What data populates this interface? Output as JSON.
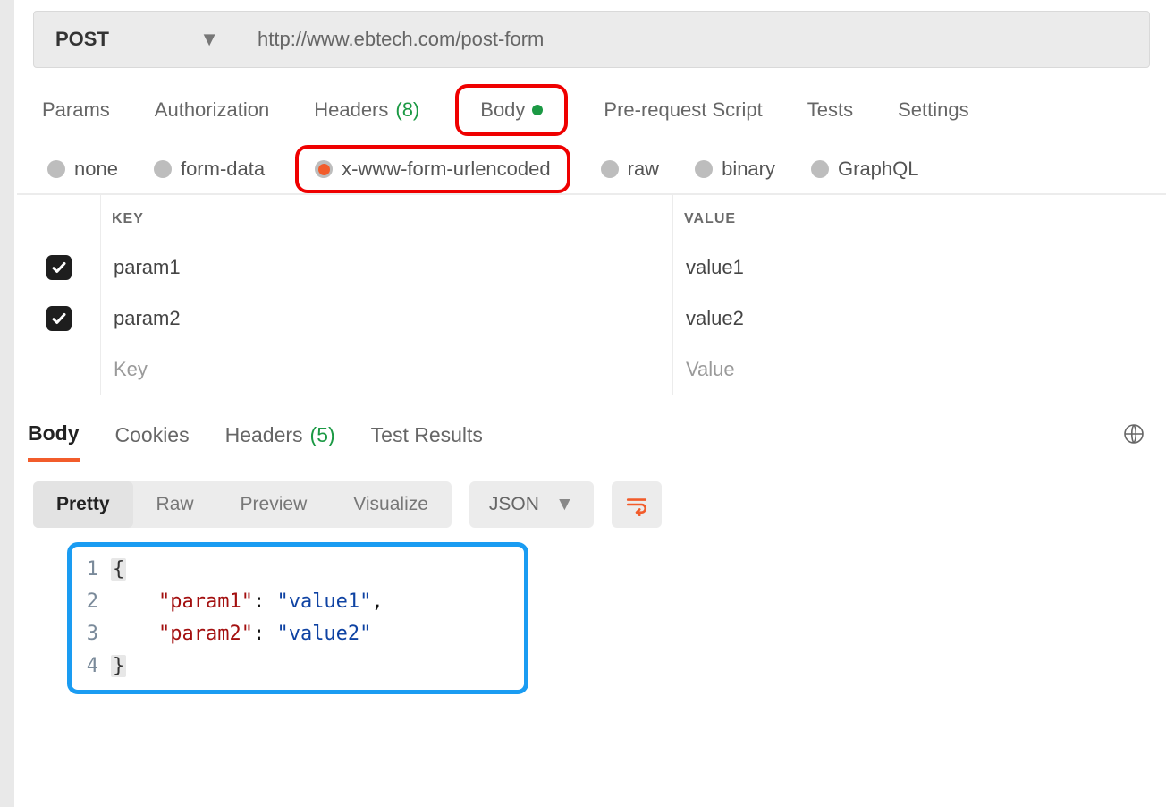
{
  "method": "POST",
  "url": "http://www.ebtech.com/post-form",
  "tabs": {
    "params": "Params",
    "authorization": "Authorization",
    "headers_label": "Headers",
    "headers_count": "(8)",
    "body": "Body",
    "pre_request": "Pre-request Script",
    "tests": "Tests",
    "settings": "Settings"
  },
  "body_types": {
    "none": "none",
    "form_data": "form-data",
    "x_www": "x-www-form-urlencoded",
    "raw": "raw",
    "binary": "binary",
    "graphql": "GraphQL"
  },
  "kv": {
    "header_key": "KEY",
    "header_value": "VALUE",
    "rows": [
      {
        "key": "param1",
        "value": "value1"
      },
      {
        "key": "param2",
        "value": "value2"
      }
    ],
    "placeholder_key": "Key",
    "placeholder_value": "Value"
  },
  "response_tabs": {
    "body": "Body",
    "cookies": "Cookies",
    "headers_label": "Headers",
    "headers_count": "(5)",
    "test_results": "Test Results"
  },
  "view_modes": {
    "pretty": "Pretty",
    "raw": "Raw",
    "preview": "Preview",
    "visualize": "Visualize",
    "lang": "JSON"
  },
  "code": {
    "l1": "{",
    "l2_key": "\"param1\"",
    "l2_val": "\"value1\"",
    "l3_key": "\"param2\"",
    "l3_val": "\"value2\"",
    "l4": "}",
    "ln1": "1",
    "ln2": "2",
    "ln3": "3",
    "ln4": "4",
    "colon_comma": ": ",
    "comma": ","
  }
}
